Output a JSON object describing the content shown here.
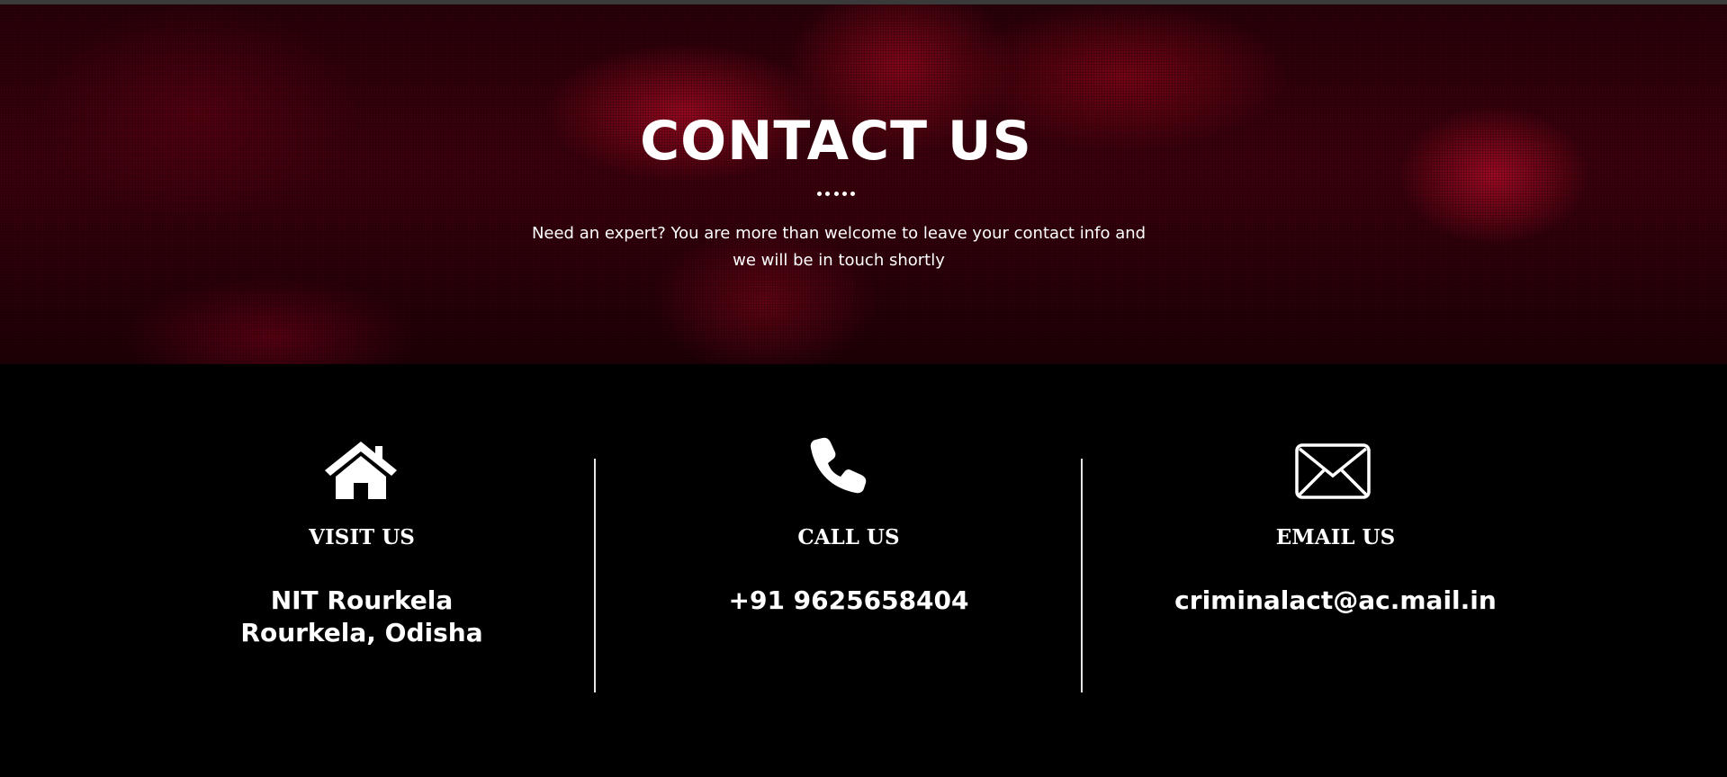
{
  "hero": {
    "title": "CONTACT US",
    "subtitle_line1": "Need an expert? You are more than welcome to leave your contact info and",
    "subtitle_line2": "we will be in touch shortly"
  },
  "contacts": {
    "visit": {
      "icon": "home-icon",
      "label": "VISIT US",
      "value_line1": "NIT Rourkela",
      "value_line2": "Rourkela, Odisha"
    },
    "call": {
      "icon": "phone-icon",
      "label": "CALL US",
      "value": "+91 9625658404"
    },
    "email": {
      "icon": "envelope-icon",
      "label": "EMAIL US",
      "value": "criminalact@ac.mail.in"
    }
  },
  "colors": {
    "background": "#000000",
    "hero_tint": "#8b0a23",
    "text": "#ffffff",
    "divider": "#e6e6e6"
  }
}
